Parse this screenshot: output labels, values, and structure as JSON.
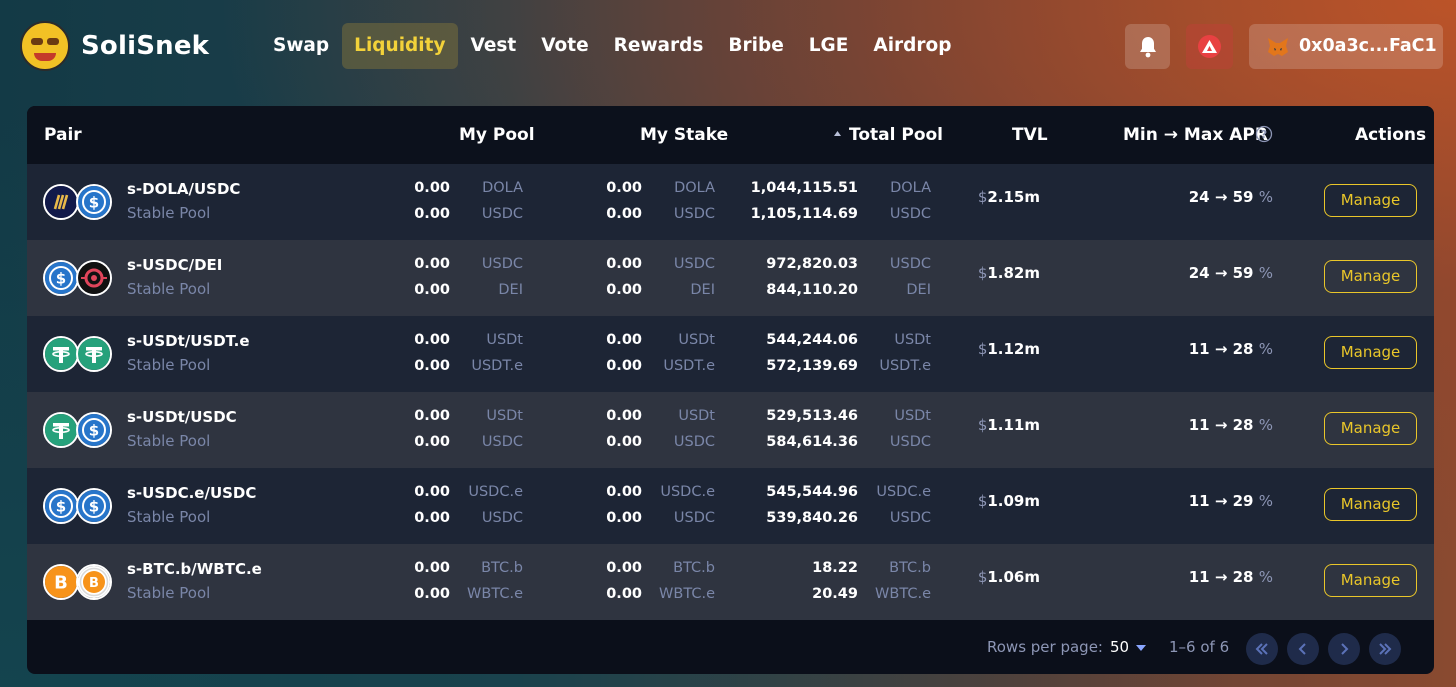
{
  "app": {
    "name": "SoliSnek"
  },
  "nav": {
    "items": [
      "Swap",
      "Liquidity",
      "Vest",
      "Vote",
      "Rewards",
      "Bribe",
      "LGE",
      "Airdrop"
    ],
    "active": "Liquidity"
  },
  "header": {
    "wallet_address": "0x0a3c...FaC1"
  },
  "colors": {
    "accent": "#e9c62a",
    "muted": "#7a86a8",
    "avax": "#e84142",
    "usdc": "#2775ca",
    "tether": "#26a17b",
    "btc": "#f7931a"
  },
  "table": {
    "headers": {
      "pair": "Pair",
      "my_pool": "My Pool",
      "my_stake": "My Stake",
      "total_pool": "Total Pool",
      "tvl": "TVL",
      "apr": "Min → Max APR",
      "actions": "Actions"
    },
    "manage_label": "Manage",
    "rows": [
      {
        "name": "s-DOLA/USDC",
        "type": "Stable Pool",
        "coins": [
          "dola-icon",
          "usdc-icon"
        ],
        "my_pool": [
          "0.00",
          "0.00"
        ],
        "my_stake": [
          "0.00",
          "0.00"
        ],
        "tokens": [
          "DOLA",
          "USDC"
        ],
        "total_pool": [
          "1,044,115.51",
          "1,105,114.69"
        ],
        "tvl_symbol": "$",
        "tvl": "2.15m",
        "apr": "24 → 59",
        "apr_unit": "%"
      },
      {
        "name": "s-USDC/DEI",
        "type": "Stable Pool",
        "coins": [
          "usdc-icon",
          "dei-icon"
        ],
        "my_pool": [
          "0.00",
          "0.00"
        ],
        "my_stake": [
          "0.00",
          "0.00"
        ],
        "tokens": [
          "USDC",
          "DEI"
        ],
        "total_pool": [
          "972,820.03",
          "844,110.20"
        ],
        "tvl_symbol": "$",
        "tvl": "1.82m",
        "apr": "24 → 59",
        "apr_unit": "%"
      },
      {
        "name": "s-USDt/USDT.e",
        "type": "Stable Pool",
        "coins": [
          "tether-icon",
          "tether-icon"
        ],
        "my_pool": [
          "0.00",
          "0.00"
        ],
        "my_stake": [
          "0.00",
          "0.00"
        ],
        "tokens": [
          "USDt",
          "USDT.e"
        ],
        "total_pool": [
          "544,244.06",
          "572,139.69"
        ],
        "tvl_symbol": "$",
        "tvl": "1.12m",
        "apr": "11 → 28",
        "apr_unit": "%"
      },
      {
        "name": "s-USDt/USDC",
        "type": "Stable Pool",
        "coins": [
          "tether-icon",
          "usdc-icon"
        ],
        "my_pool": [
          "0.00",
          "0.00"
        ],
        "my_stake": [
          "0.00",
          "0.00"
        ],
        "tokens": [
          "USDt",
          "USDC"
        ],
        "total_pool": [
          "529,513.46",
          "584,614.36"
        ],
        "tvl_symbol": "$",
        "tvl": "1.11m",
        "apr": "11 → 28",
        "apr_unit": "%"
      },
      {
        "name": "s-USDC.e/USDC",
        "type": "Stable Pool",
        "coins": [
          "usdc-icon",
          "usdc-icon"
        ],
        "my_pool": [
          "0.00",
          "0.00"
        ],
        "my_stake": [
          "0.00",
          "0.00"
        ],
        "tokens": [
          "USDC.e",
          "USDC"
        ],
        "total_pool": [
          "545,544.96",
          "539,840.26"
        ],
        "tvl_symbol": "$",
        "tvl": "1.09m",
        "apr": "11 → 29",
        "apr_unit": "%"
      },
      {
        "name": "s-BTC.b/WBTC.e",
        "type": "Stable Pool",
        "coins": [
          "btc-icon",
          "wbtc-icon"
        ],
        "my_pool": [
          "0.00",
          "0.00"
        ],
        "my_stake": [
          "0.00",
          "0.00"
        ],
        "tokens": [
          "BTC.b",
          "WBTC.e"
        ],
        "total_pool": [
          "18.22",
          "20.49"
        ],
        "tvl_symbol": "$",
        "tvl": "1.06m",
        "apr": "11 → 28",
        "apr_unit": "%"
      }
    ]
  },
  "pagination": {
    "rows_per_page_label": "Rows per page:",
    "rows_per_page": "50",
    "range": "1–6 of 6"
  }
}
